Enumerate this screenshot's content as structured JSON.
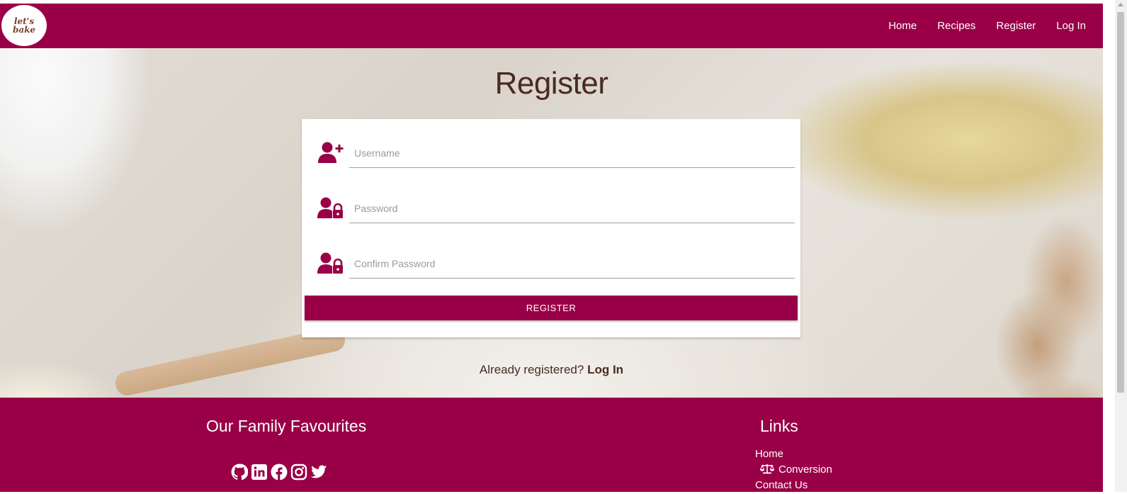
{
  "brand": {
    "logo_text": "let's\nbake",
    "primary_color": "#990047"
  },
  "nav": {
    "home": "Home",
    "recipes": "Recipes",
    "register": "Register",
    "login": "Log In"
  },
  "page": {
    "title": "Register"
  },
  "form": {
    "username_placeholder": "Username",
    "password_placeholder": "Password",
    "confirm_placeholder": "Confirm Password",
    "submit_label": "REGISTER",
    "username_icon": "user-plus-icon",
    "password_icon": "user-lock-icon"
  },
  "login_prompt": {
    "text": "Already registered?",
    "link": "Log In"
  },
  "footer": {
    "left_title": "Our Family Favourites",
    "right_title": "Links",
    "social_icons": [
      "github-icon",
      "linkedin-icon",
      "facebook-icon",
      "instagram-icon",
      "twitter-icon"
    ],
    "links": [
      {
        "label": "Home"
      },
      {
        "label": "Conversion",
        "icon": "balance-scale-icon"
      },
      {
        "label": "Contact Us"
      }
    ]
  }
}
